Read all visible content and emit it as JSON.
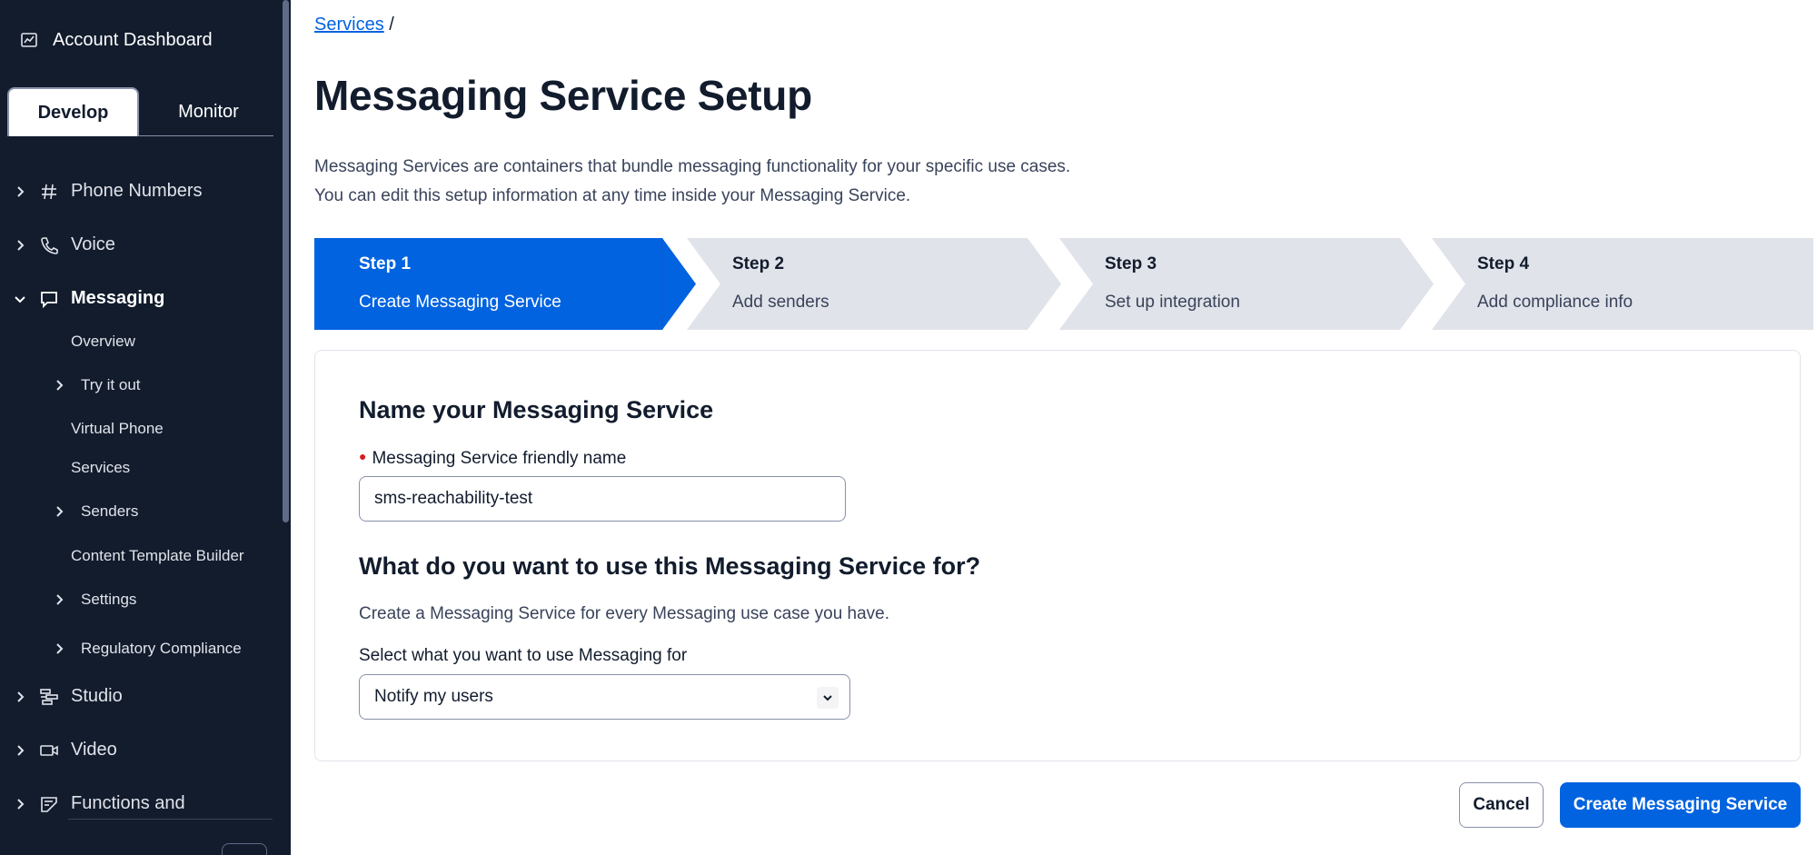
{
  "sidebar": {
    "account_label": "Account Dashboard",
    "tabs": [
      {
        "label": "Develop",
        "active": true
      },
      {
        "label": "Monitor",
        "active": false
      }
    ],
    "nav": {
      "phone_numbers": "Phone Numbers",
      "voice": "Voice",
      "messaging": "Messaging",
      "studio": "Studio",
      "video": "Video",
      "functions": "Functions and"
    },
    "messaging_sub": {
      "overview": "Overview",
      "try_it_out": "Try it out",
      "virtual_phone": "Virtual Phone",
      "services": "Services",
      "senders": "Senders",
      "content_template_builder": "Content Template Builder",
      "settings": "Settings",
      "regulatory_compliance": "Regulatory Compliance"
    }
  },
  "breadcrumb": {
    "link": "Services",
    "separator": "/"
  },
  "page": {
    "title": "Messaging Service Setup",
    "description_line1": "Messaging Services are containers that bundle messaging functionality for your specific use cases.",
    "description_line2": "You can edit this setup information at any time inside your Messaging Service."
  },
  "stepper": {
    "steps": [
      {
        "number": "Step 1",
        "label": "Create Messaging Service",
        "active": true
      },
      {
        "number": "Step 2",
        "label": "Add senders",
        "active": false
      },
      {
        "number": "Step 3",
        "label": "Set up integration",
        "active": false
      },
      {
        "number": "Step 4",
        "label": "Add compliance info",
        "active": false
      }
    ]
  },
  "form": {
    "name_heading": "Name your Messaging Service",
    "name_label": "Messaging Service friendly name",
    "name_value": "sms-reachability-test",
    "use_heading": "What do you want to use this Messaging Service for?",
    "use_help": "Create a Messaging Service for every Messaging use case you have.",
    "use_label": "Select what you want to use Messaging for",
    "use_selected": "Notify my users"
  },
  "footer": {
    "cancel_label": "Cancel",
    "create_label": "Create Messaging Service"
  },
  "colors": {
    "sidebar_bg": "#121c2d",
    "primary": "#0263e0",
    "step_inactive_bg": "#e1e3ea",
    "required": "#d61f1f"
  }
}
